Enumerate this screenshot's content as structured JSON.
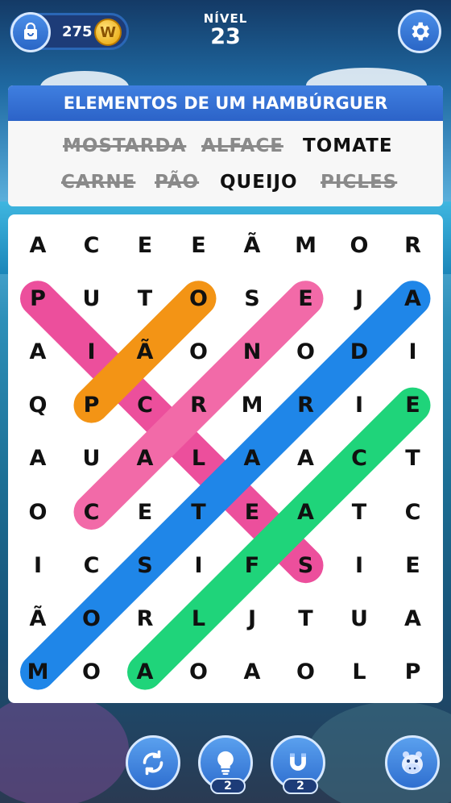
{
  "header": {
    "coins": "275",
    "coin_symbol": "W",
    "level_label": "NÍVEL",
    "level_number": "23"
  },
  "category": "ELEMENTOS DE UM HAMBÚRGUER",
  "words": [
    {
      "text": "MOSTARDA",
      "found": true
    },
    {
      "text": "ALFACE",
      "found": true
    },
    {
      "text": "TOMATE",
      "found": false
    },
    {
      "text": "CARNE",
      "found": true
    },
    {
      "text": "PÃO",
      "found": true
    },
    {
      "text": "QUEIJO",
      "found": false
    },
    {
      "text": "PICLES",
      "found": true
    }
  ],
  "grid": [
    [
      "A",
      "C",
      "E",
      "E",
      "Ã",
      "M",
      "O",
      "R"
    ],
    [
      "P",
      "U",
      "T",
      "O",
      "S",
      "E",
      "J",
      "A"
    ],
    [
      "A",
      "I",
      "Ã",
      "O",
      "N",
      "O",
      "D",
      "I"
    ],
    [
      "Q",
      "P",
      "C",
      "R",
      "M",
      "R",
      "I",
      "E"
    ],
    [
      "A",
      "U",
      "A",
      "L",
      "A",
      "A",
      "C",
      "T"
    ],
    [
      "O",
      "C",
      "E",
      "T",
      "E",
      "A",
      "T",
      "C"
    ],
    [
      "I",
      "C",
      "S",
      "I",
      "F",
      "S",
      "I",
      "E"
    ],
    [
      "Ã",
      "O",
      "R",
      "L",
      "J",
      "T",
      "U",
      "A"
    ],
    [
      "M",
      "O",
      "A",
      "O",
      "A",
      "O",
      "L",
      "P"
    ]
  ],
  "highlights": [
    {
      "word": "PICLES",
      "color": "#ec4f9c",
      "from": [
        1,
        0
      ],
      "to": [
        6,
        5
      ]
    },
    {
      "word": "PÃO",
      "color": "#f39415",
      "from": [
        3,
        1
      ],
      "to": [
        1,
        3
      ]
    },
    {
      "word": "CARNE",
      "color": "#f26aa8",
      "from": [
        5,
        1
      ],
      "to": [
        1,
        5
      ]
    },
    {
      "word": "MOSTARDA",
      "color": "#1f86e8",
      "from": [
        8,
        0
      ],
      "to": [
        1,
        7
      ]
    },
    {
      "word": "ALFACE",
      "color": "#1fd47a",
      "from": [
        8,
        2
      ],
      "to": [
        3,
        7
      ]
    }
  ],
  "tools": [
    {
      "name": "shuffle",
      "count": ""
    },
    {
      "name": "hint",
      "count": "2"
    },
    {
      "name": "magnet",
      "count": "2"
    }
  ],
  "colors": {
    "panel_header": "#2c63c8",
    "found_word": "#8a8a8a"
  }
}
